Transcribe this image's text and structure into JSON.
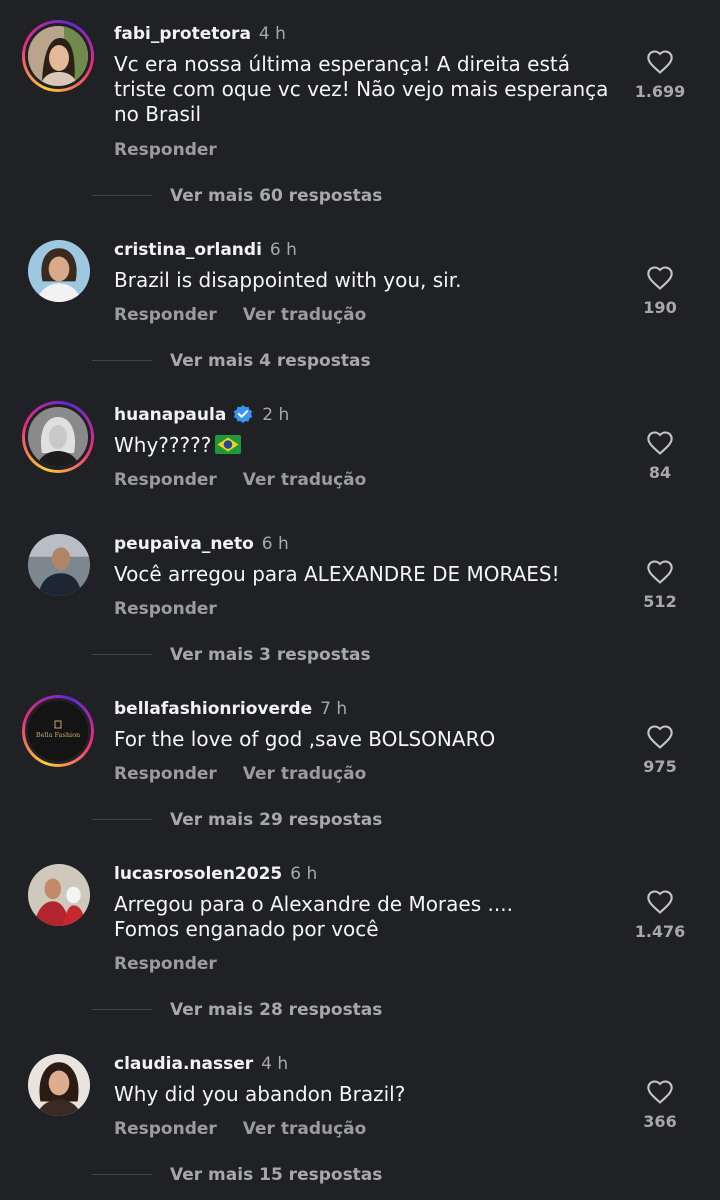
{
  "colors": {
    "background": "#202124",
    "text": "#f5f5f5",
    "muted": "#a8a8a8",
    "verified": "#3797f0"
  },
  "labels": {
    "reply": "Responder",
    "translate": "Ver tradução"
  },
  "comments": [
    {
      "username": "fabi_protetora",
      "time": "4 h",
      "text": "Vc era nossa última esperança! A direita está triste com oque vc vez! Não vejo mais esperança no Brasil",
      "likes": "1.699",
      "more_replies": "Ver mais 60 respostas",
      "avatar_icon": "woman-photo-icon"
    },
    {
      "username": "cristina_orlandi",
      "time": "6 h",
      "text": "Brazil is disappointed with you, sir.",
      "likes": "190",
      "more_replies": "Ver mais 4 respostas",
      "avatar_icon": "woman-photo-icon"
    },
    {
      "username": "huanapaula",
      "time": "2 h",
      "text": "Why?????",
      "likes": "84",
      "avatar_icon": "woman-photo-icon",
      "badge_icon": "verified-icon",
      "emoji_icon": "brazil-flag-icon"
    },
    {
      "username": "peupaiva_neto",
      "time": "6 h",
      "text": "Você arregou para ALEXANDRE DE MORAES!",
      "likes": "512",
      "more_replies": "Ver mais 3 respostas",
      "avatar_icon": "man-photo-icon"
    },
    {
      "username": "bellafashionrioverde",
      "time": "7 h",
      "text": "For the love of god ,save BOLSONARO",
      "likes": "975",
      "more_replies": "Ver mais 29 respostas",
      "avatar_icon": "store-logo-icon",
      "logo_text": "Bella Fashion"
    },
    {
      "username": "lucasrosolen2025",
      "time": "6 h",
      "text": "Arregou para o Alexandre de Moraes .... Fomos enganado por você",
      "likes": "1.476",
      "more_replies": "Ver mais 28 respostas",
      "avatar_icon": "man-photo-icon"
    },
    {
      "username": "claudia.nasser",
      "time": "4 h",
      "text": "Why did you abandon Brazil?",
      "likes": "366",
      "more_replies": "Ver mais 15 respostas",
      "avatar_icon": "woman-photo-icon"
    }
  ]
}
